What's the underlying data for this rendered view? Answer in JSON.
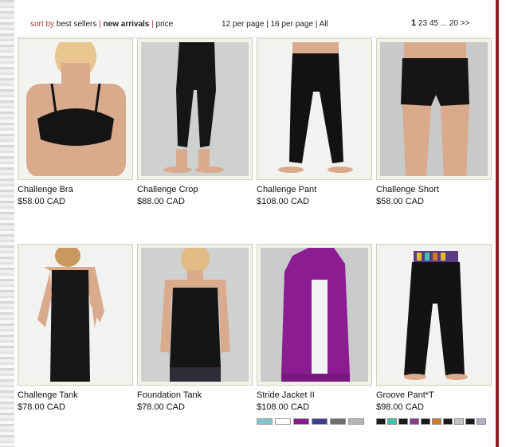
{
  "toolbar": {
    "sort_label": "sort by",
    "sort_options": [
      "best sellers",
      "new arrivals",
      "price"
    ],
    "active_sort": "new arrivals",
    "per_page_options": [
      "12 per page",
      "16 per page",
      "All"
    ],
    "pagination": {
      "current": "1",
      "pages": [
        "2",
        "3",
        "4",
        "5"
      ],
      "ellipsis": "...",
      "last": "20",
      "next": ">>"
    }
  },
  "products": [
    {
      "name": "Challenge Bra",
      "price": "$58.00 CAD"
    },
    {
      "name": "Challenge Crop",
      "price": "$88.00 CAD"
    },
    {
      "name": "Challenge Pant",
      "price": "$108.00 CAD"
    },
    {
      "name": "Challenge Short",
      "price": "$58.00 CAD"
    },
    {
      "name": "Challenge Tank",
      "price": "$78.00 CAD"
    },
    {
      "name": "Foundation Tank",
      "price": "$78.00 CAD"
    },
    {
      "name": "Stride Jacket II",
      "price": "$108.00 CAD",
      "swatches": [
        "#7fc7cc",
        "#ffffff",
        "#8c1a8f",
        "#3d3d8f",
        "#6e6e6e",
        "#b5b5b5"
      ]
    },
    {
      "name": "Groove Pant*T",
      "price": "$98.00 CAD",
      "swatches": [
        "#1a1a1a",
        "#3cc4b0",
        "#1a1a1a",
        "#8a3a8a",
        "#1a1a1a",
        "#d07a2a",
        "#1a1a1a",
        "#c4c4c4",
        "#1a1a1a",
        "#b0b0c8"
      ]
    }
  ],
  "colors": {
    "accent": "#b33a33",
    "border_brand": "#8f1f2a"
  }
}
